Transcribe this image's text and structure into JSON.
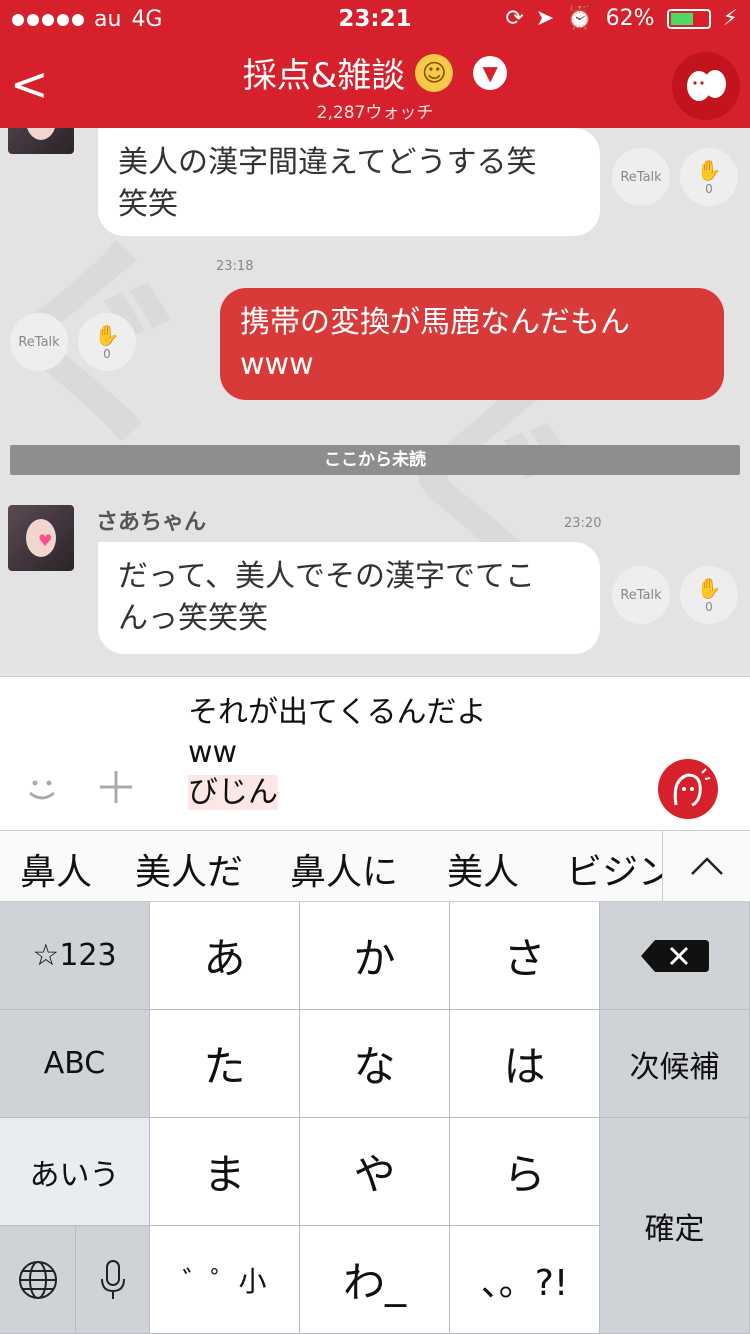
{
  "status": {
    "carrier": "au",
    "network": "4G",
    "time": "23:21",
    "battery": "62%",
    "battery_level": 0.62
  },
  "nav": {
    "back": "<",
    "title": "採点&雑談",
    "emoji": "☺",
    "watchers": "2,287ウォッチ",
    "dropdown_icon": "chevron-down"
  },
  "chat": {
    "messages": [
      {
        "text_l1": "美人の漢字間違えてどうする笑",
        "text_l2": "笑笑",
        "retalk": "ReTalk",
        "claps": "0"
      },
      {
        "time": "23:18",
        "text_l1": "携帯の変換が馬鹿なんだもん",
        "text_l2": "www",
        "retalk": "ReTalk",
        "claps": "0"
      },
      {
        "sender": "さあちゃん",
        "time": "23:20",
        "text_l1": "だって、美人でその漢字でてこ",
        "text_l2": "んっ笑笑笑",
        "retalk": "ReTalk",
        "claps": "0"
      }
    ],
    "unread_label": "ここから未読"
  },
  "input": {
    "line1": "それが出てくるんだよ",
    "line2": "ww",
    "composing": "びじん"
  },
  "candidates": [
    "鼻人",
    "美人だ",
    "鼻人に",
    "美人",
    "ビジン"
  ],
  "keyboard": {
    "numsym": "☆123",
    "a": "あ",
    "ka": "か",
    "sa": "さ",
    "abc": "ABC",
    "ta": "た",
    "na": "な",
    "ha": "は",
    "next": "次候補",
    "kana": "あいう",
    "ma": "ま",
    "ya": "や",
    "ra": "ら",
    "confirm": "確定",
    "dakuten": "゛゜小",
    "wa": "わ_",
    "punct": "、。?!"
  }
}
